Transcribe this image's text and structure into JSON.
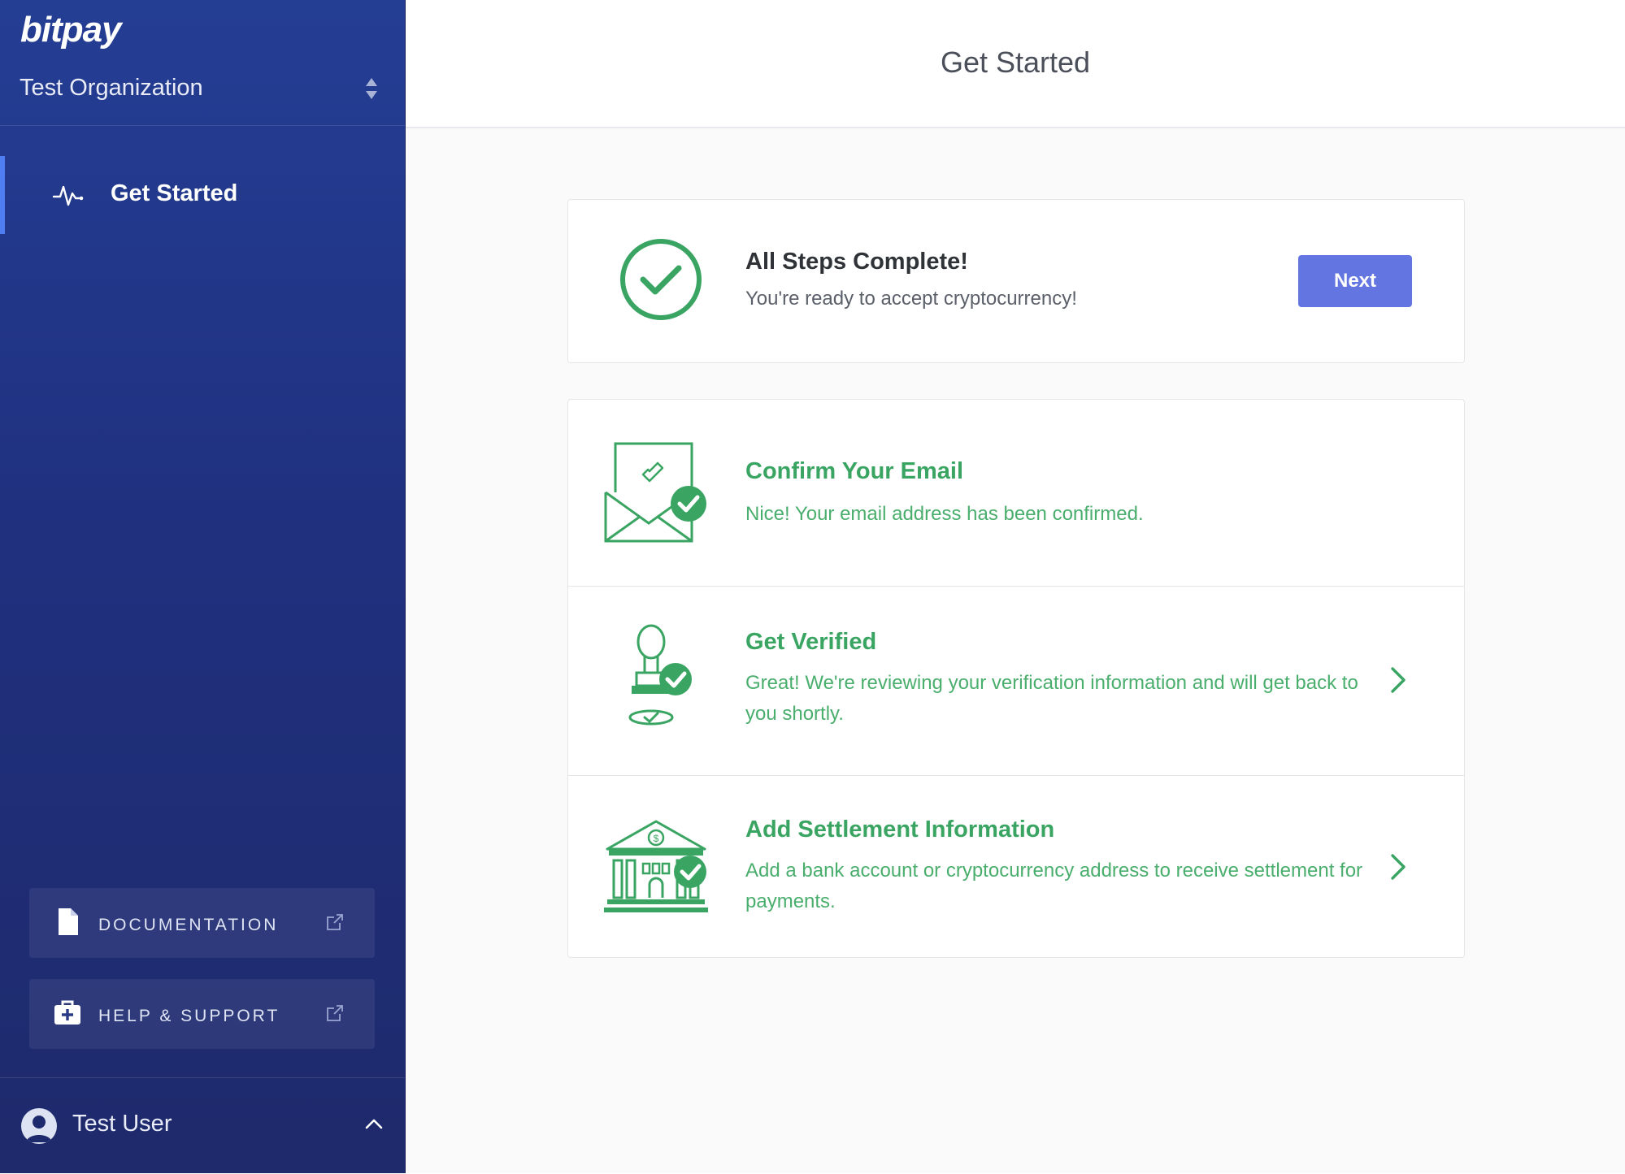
{
  "sidebar": {
    "logo": "bitpay",
    "organization": "Test Organization",
    "nav": [
      {
        "label": "Get Started",
        "icon": "activity-icon",
        "active": true
      }
    ],
    "links": [
      {
        "label": "DOCUMENTATION",
        "icon": "document-icon",
        "external_icon": "external-link-icon"
      },
      {
        "label": "HELP & SUPPORT",
        "icon": "first-aid-kit-icon",
        "external_icon": "external-link-icon"
      }
    ],
    "user": {
      "name": "Test User",
      "icon": "user-avatar-icon",
      "toggle_icon": "chevron-up-icon"
    }
  },
  "header": {
    "title": "Get Started"
  },
  "completion": {
    "icon": "check-circle-icon",
    "title": "All Steps Complete!",
    "subtitle": "You're ready to accept cryptocurrency!",
    "button": "Next"
  },
  "steps": [
    {
      "icon": "email-confirmed-icon",
      "title": "Confirm Your Email",
      "description": "Nice! Your email address has been confirmed."
    },
    {
      "icon": "stamp-verified-icon",
      "title": "Get Verified",
      "description": "Great! We're reviewing your verification information and will get back to you shortly.",
      "chevron": "chevron-right-icon"
    },
    {
      "icon": "bank-verified-icon",
      "title": "Add Settlement Information",
      "description": "Add a bank account or cryptocurrency address to receive settlement for payments.",
      "chevron": "chevron-right-icon"
    }
  ],
  "colors": {
    "sidebar_top": "#243e94",
    "sidebar_bottom": "#1e2a6b",
    "accent": "#6275e0",
    "success": "#3aa562",
    "active_indicator": "#4f7ef2"
  }
}
